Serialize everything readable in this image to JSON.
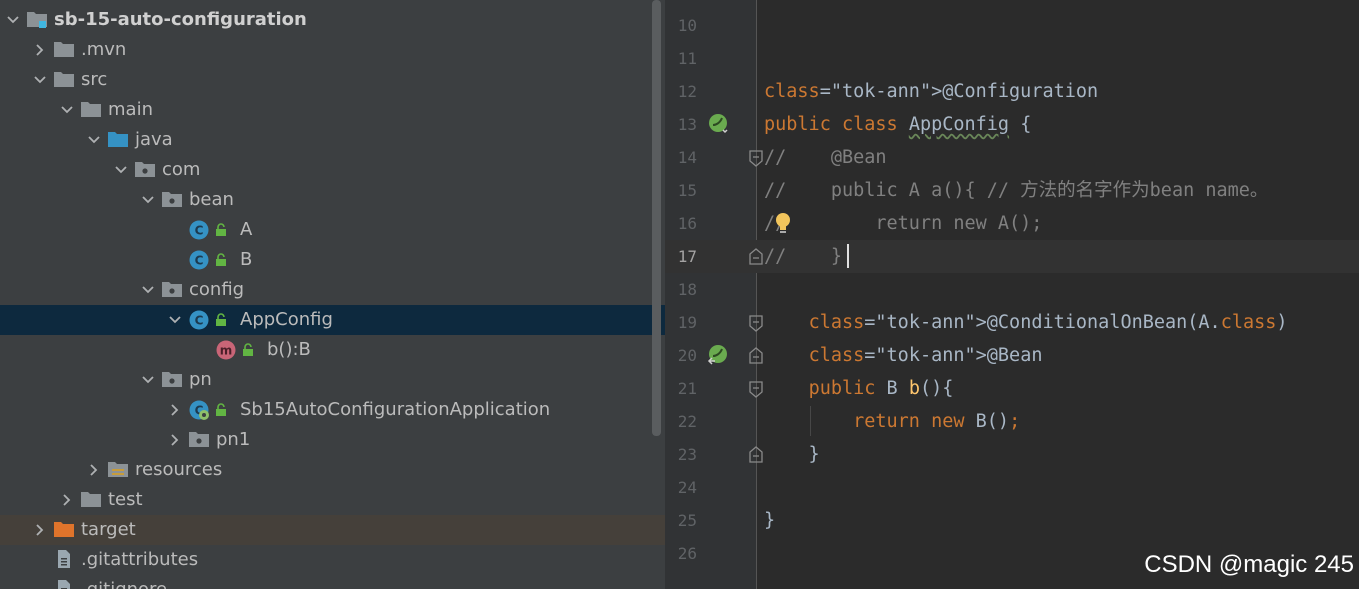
{
  "project_tree": {
    "items": [
      {
        "label": "sb-15-auto-configuration",
        "icon": "module-folder-icon",
        "arrow": "expanded"
      },
      {
        "label": ".mvn",
        "icon": "folder-icon",
        "arrow": "collapsed"
      },
      {
        "label": "src",
        "icon": "folder-icon",
        "arrow": "expanded"
      },
      {
        "label": "main",
        "icon": "folder-icon",
        "arrow": "expanded"
      },
      {
        "label": "java",
        "icon": "source-root-folder-icon",
        "arrow": "expanded"
      },
      {
        "label": "com",
        "icon": "package-icon",
        "arrow": "expanded"
      },
      {
        "label": "bean",
        "icon": "package-icon",
        "arrow": "expanded"
      },
      {
        "label": "A",
        "icon": "class-icon",
        "arrow": "none"
      },
      {
        "label": "B",
        "icon": "class-icon",
        "arrow": "none"
      },
      {
        "label": "config",
        "icon": "package-icon",
        "arrow": "expanded"
      },
      {
        "label": "AppConfig",
        "icon": "class-icon",
        "arrow": "expanded",
        "selected": true
      },
      {
        "label": "b():B",
        "icon": "method-icon",
        "arrow": "none"
      },
      {
        "label": "pn",
        "icon": "package-icon",
        "arrow": "expanded"
      },
      {
        "label": "Sb15AutoConfigurationApplication",
        "icon": "spring-boot-class-icon",
        "arrow": "collapsed"
      },
      {
        "label": "pn1",
        "icon": "package-icon",
        "arrow": "collapsed"
      },
      {
        "label": "resources",
        "icon": "resources-folder-icon",
        "arrow": "collapsed"
      },
      {
        "label": "test",
        "icon": "folder-icon",
        "arrow": "collapsed"
      },
      {
        "label": "target",
        "icon": "excluded-folder-icon",
        "arrow": "collapsed",
        "excluded": true
      },
      {
        "label": ".gitattributes",
        "icon": "file-icon",
        "arrow": "none"
      },
      {
        "label": ".gitignore",
        "icon": "file-icon",
        "arrow": "none"
      }
    ]
  },
  "editor": {
    "current_line": "17",
    "lines": [
      {
        "number": "10",
        "text": ""
      },
      {
        "number": "11",
        "text": ""
      },
      {
        "number": "12",
        "text": "@Configuration"
      },
      {
        "number": "13",
        "text": "public class AppConfig {"
      },
      {
        "number": "14",
        "text": "//    @Bean"
      },
      {
        "number": "15",
        "text": "//    public A a(){ // 方法的名字作为bean name。"
      },
      {
        "number": "16",
        "text": "//        return new A();"
      },
      {
        "number": "17",
        "text": "//    }"
      },
      {
        "number": "18",
        "text": ""
      },
      {
        "number": "19",
        "text": "    @ConditionalOnBean(A.class)"
      },
      {
        "number": "20",
        "text": "    @Bean"
      },
      {
        "number": "21",
        "text": "    public B b(){"
      },
      {
        "number": "22",
        "text": "        return new B();"
      },
      {
        "number": "23",
        "text": "    }"
      },
      {
        "number": "24",
        "text": ""
      },
      {
        "number": "25",
        "text": "}"
      },
      {
        "number": "26",
        "text": ""
      }
    ]
  },
  "watermark": "CSDN @magic 245",
  "colors": {
    "keyword": "#cc7832",
    "annotation": "#bbb529",
    "method_declaration": "#ffc66d",
    "comment": "#808080",
    "default_text": "#a9b7c6",
    "selection": "#0d293e"
  }
}
